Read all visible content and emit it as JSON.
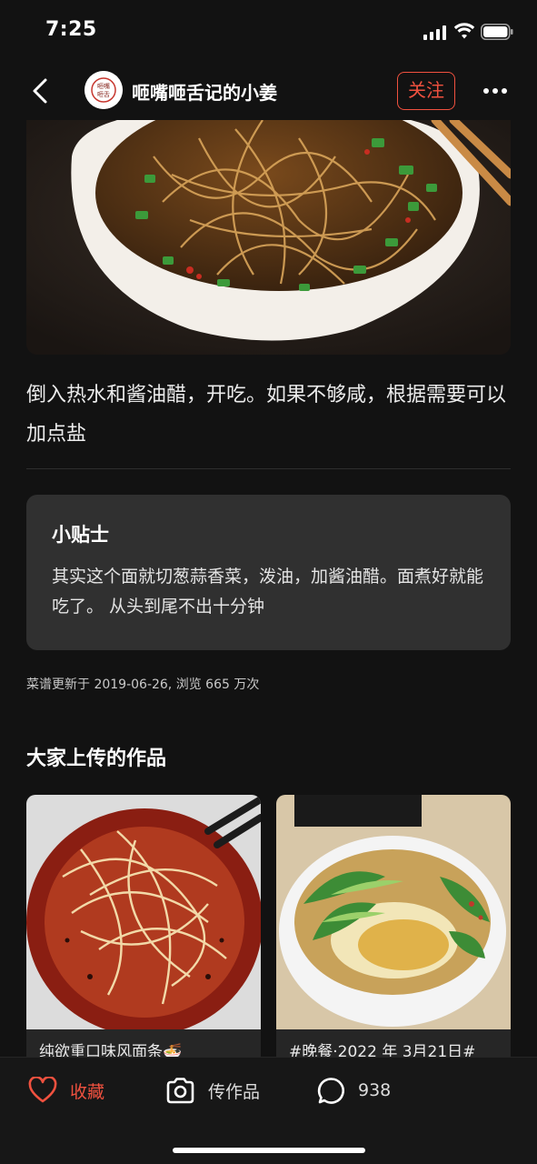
{
  "status_bar": {
    "time": "7:25"
  },
  "nav": {
    "author_name": "咂嘴咂舌记的小姜",
    "follow_label": "关注",
    "avatar_text": "咂嘴咂舌"
  },
  "step": {
    "text": "倒入热水和酱油醋，开吃。如果不够咸，根据需要可以加点盐"
  },
  "tips": {
    "title": "小贴士",
    "body": "其实这个面就切葱蒜香菜，泼油，加酱油醋。面煮好就能吃了。 从头到尾不出十分钟"
  },
  "meta": "菜谱更新于 2019-06-26, 浏览 665 万次",
  "uploads": {
    "title": "大家上传的作品",
    "items": [
      {
        "caption": "纯欲重口味风面条🍜"
      },
      {
        "caption": "#晚餐·2022 年 3月21日#"
      }
    ]
  },
  "bottom_bar": {
    "favorite_label": "收藏",
    "upload_label": "传作品",
    "comment_count": "938"
  },
  "colors": {
    "accent": "#f0513f",
    "background": "#121212",
    "card": "#303030"
  }
}
